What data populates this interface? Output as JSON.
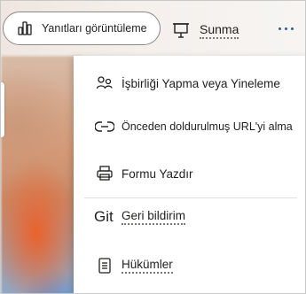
{
  "toolbar": {
    "responses_label": "Yanıtları görüntüleme",
    "present_label": "Sunma"
  },
  "menu": {
    "items": [
      {
        "label": "İşbirliği Yapma veya Yineleme",
        "icon": "collaborate-icon"
      },
      {
        "label": "Önceden doldurulmuş URL'yi alma",
        "icon": "link-icon"
      },
      {
        "label": "Formu Yazdır",
        "icon": "print-icon"
      },
      {
        "label": "Geri bildirim",
        "icon_text": "Git"
      },
      {
        "label": "Hükümler",
        "icon": "document-icon"
      }
    ]
  },
  "colors": {
    "text": "#201f1e",
    "accent_dots": "#2f5d8c",
    "border": "#8a8886"
  }
}
